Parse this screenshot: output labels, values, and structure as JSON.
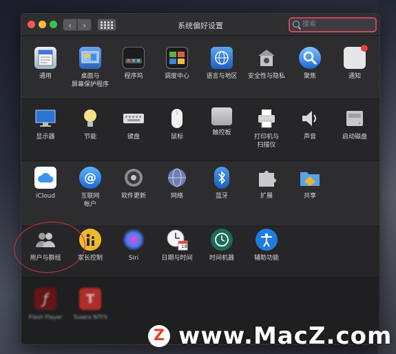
{
  "window": {
    "title": "系统偏好设置",
    "nav_back": "‹",
    "nav_forward": "›",
    "search_placeholder": "搜索"
  },
  "rows": [
    [
      {
        "label": "通用",
        "icon": "general-icon"
      },
      {
        "label": "桌面与\n屏幕保护程序",
        "icon": "desktop-screensaver-icon"
      },
      {
        "label": "程序坞",
        "icon": "dock-icon"
      },
      {
        "label": "调度中心",
        "icon": "mission-control-icon"
      },
      {
        "label": "语言与地区",
        "icon": "language-region-icon"
      },
      {
        "label": "安全性与隐私",
        "icon": "security-privacy-icon"
      },
      {
        "label": "聚焦",
        "icon": "spotlight-icon"
      },
      {
        "label": "通知",
        "icon": "notifications-icon"
      }
    ],
    [
      {
        "label": "显示器",
        "icon": "displays-icon"
      },
      {
        "label": "节能",
        "icon": "energy-saver-icon"
      },
      {
        "label": "键盘",
        "icon": "keyboard-icon"
      },
      {
        "label": "鼠标",
        "icon": "mouse-icon"
      },
      {
        "label": "触控板",
        "icon": "trackpad-icon"
      },
      {
        "label": "打印机与\n扫描仪",
        "icon": "printers-scanners-icon"
      },
      {
        "label": "声音",
        "icon": "sound-icon"
      },
      {
        "label": "启动磁盘",
        "icon": "startup-disk-icon"
      }
    ],
    [
      {
        "label": "iCloud",
        "icon": "icloud-icon"
      },
      {
        "label": "互联网\n帐户",
        "icon": "internet-accounts-icon"
      },
      {
        "label": "软件更新",
        "icon": "software-update-icon"
      },
      {
        "label": "网络",
        "icon": "network-icon"
      },
      {
        "label": "蓝牙",
        "icon": "bluetooth-icon"
      },
      {
        "label": "扩展",
        "icon": "extensions-icon"
      },
      {
        "label": "共享",
        "icon": "sharing-icon"
      }
    ],
    [
      {
        "label": "用户与群组",
        "icon": "users-groups-icon"
      },
      {
        "label": "家长控制",
        "icon": "parental-controls-icon"
      },
      {
        "label": "Siri",
        "icon": "siri-icon"
      },
      {
        "label": "日期与时间",
        "icon": "date-time-icon"
      },
      {
        "label": "时间机器",
        "icon": "time-machine-icon"
      },
      {
        "label": "辅助功能",
        "icon": "accessibility-icon"
      }
    ],
    [
      {
        "label": "Flash Player",
        "icon": "flash-player-icon"
      },
      {
        "label": "Tuxera NTFS",
        "icon": "tuxera-ntfs-icon"
      }
    ]
  ],
  "date_icon_day": "18",
  "watermark": {
    "logo": "Z",
    "text": "www.MacZ.com"
  },
  "colors": {
    "annotation_circle": "#d0343a",
    "search_border": "#c9465b"
  }
}
